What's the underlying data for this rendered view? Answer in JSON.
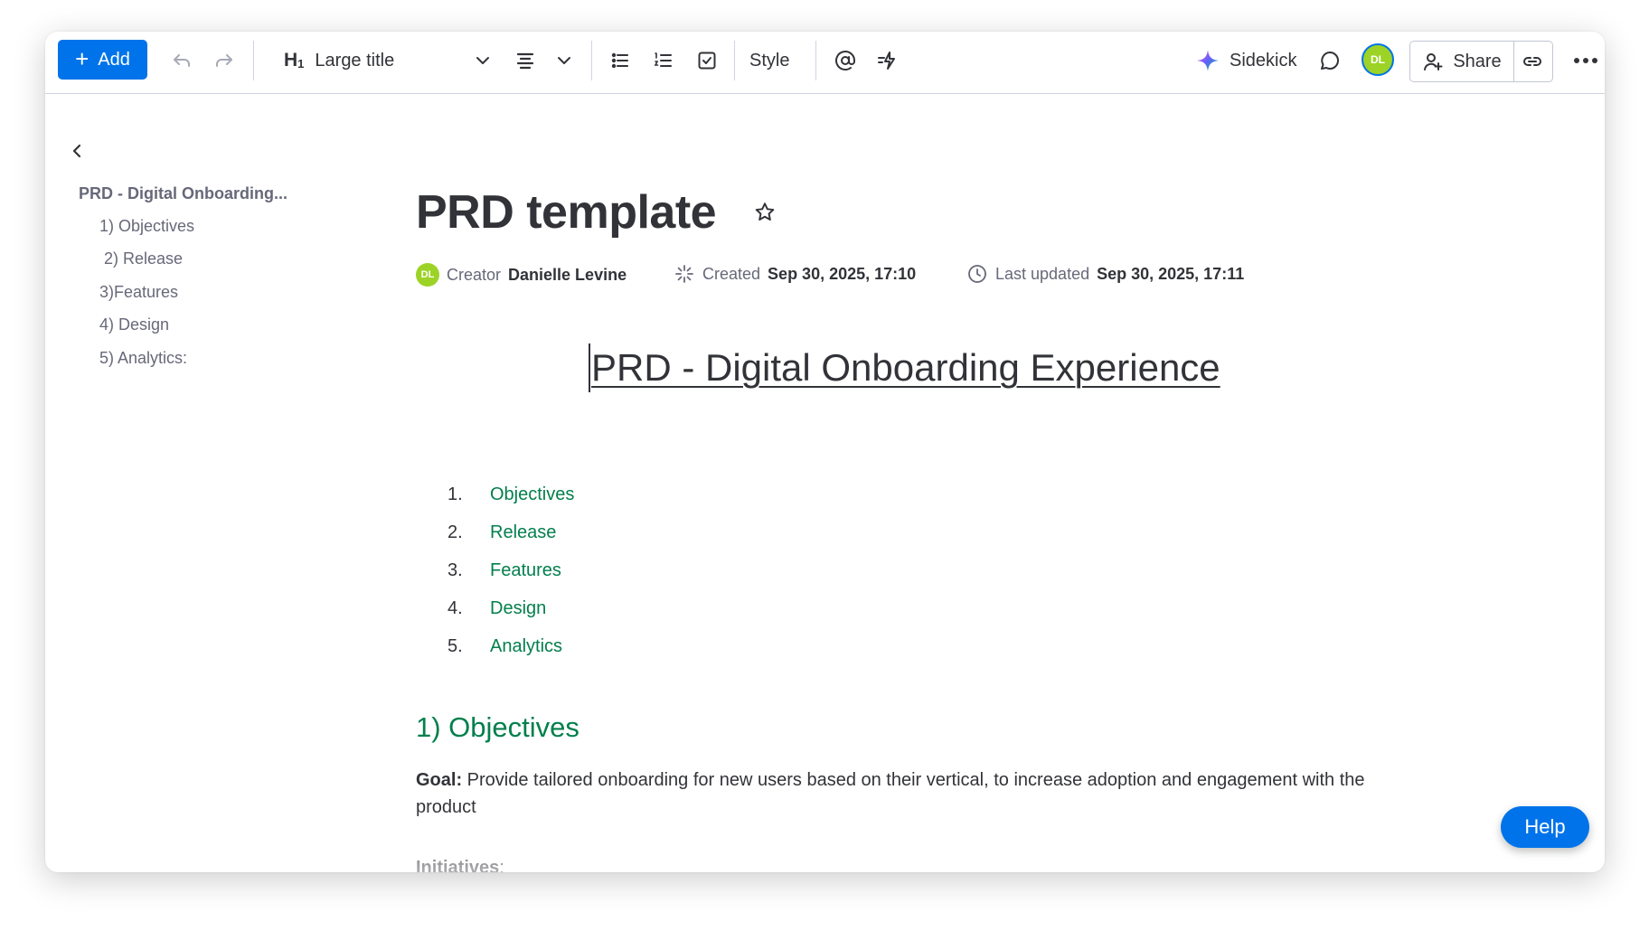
{
  "toolbar": {
    "add_label": "Add",
    "text_style": "Large title",
    "heading_mark": "H",
    "heading_sub": "1",
    "style_label": "Style",
    "sidekick_label": "Sidekick",
    "avatar_initials": "DL",
    "share_label": "Share"
  },
  "sidebar": {
    "title": "PRD - Digital Onboarding...",
    "items": [
      {
        "label": "1) Objectives"
      },
      {
        "label": "2) Release"
      },
      {
        "label": "3)Features"
      },
      {
        "label": "4) Design"
      },
      {
        "label": "5) Analytics:"
      }
    ]
  },
  "doc": {
    "title": "PRD template",
    "meta": {
      "avatar_initials": "DL",
      "creator_label": "Creator",
      "creator_name": "Danielle Levine",
      "created_label": "Created",
      "created_value": "Sep 30, 2025, 17:10",
      "updated_label": "Last updated",
      "updated_value": "Sep 30, 2025, 17:11"
    },
    "heading": "PRD - Digital Onboarding Experience",
    "list": [
      {
        "num": "1.",
        "label": "Objectives"
      },
      {
        "num": "2.",
        "label": "Release"
      },
      {
        "num": "3.",
        "label": "Features"
      },
      {
        "num": "4.",
        "label": "Design"
      },
      {
        "num": "5.",
        "label": "Analytics"
      }
    ],
    "section_heading": "1) Objectives",
    "goal_label": "Goal:",
    "goal_text": " Provide tailored onboarding for new users based on their vertical, to increase adoption and engagement with the product",
    "initiatives_label": "Initiatives",
    "initiatives_colon": ":"
  },
  "help_label": "Help",
  "colors": {
    "primary": "#0073ea",
    "link_green": "#037f4c",
    "avatar_green": "#9cd326",
    "text": "#323338",
    "muted": "#676879"
  }
}
